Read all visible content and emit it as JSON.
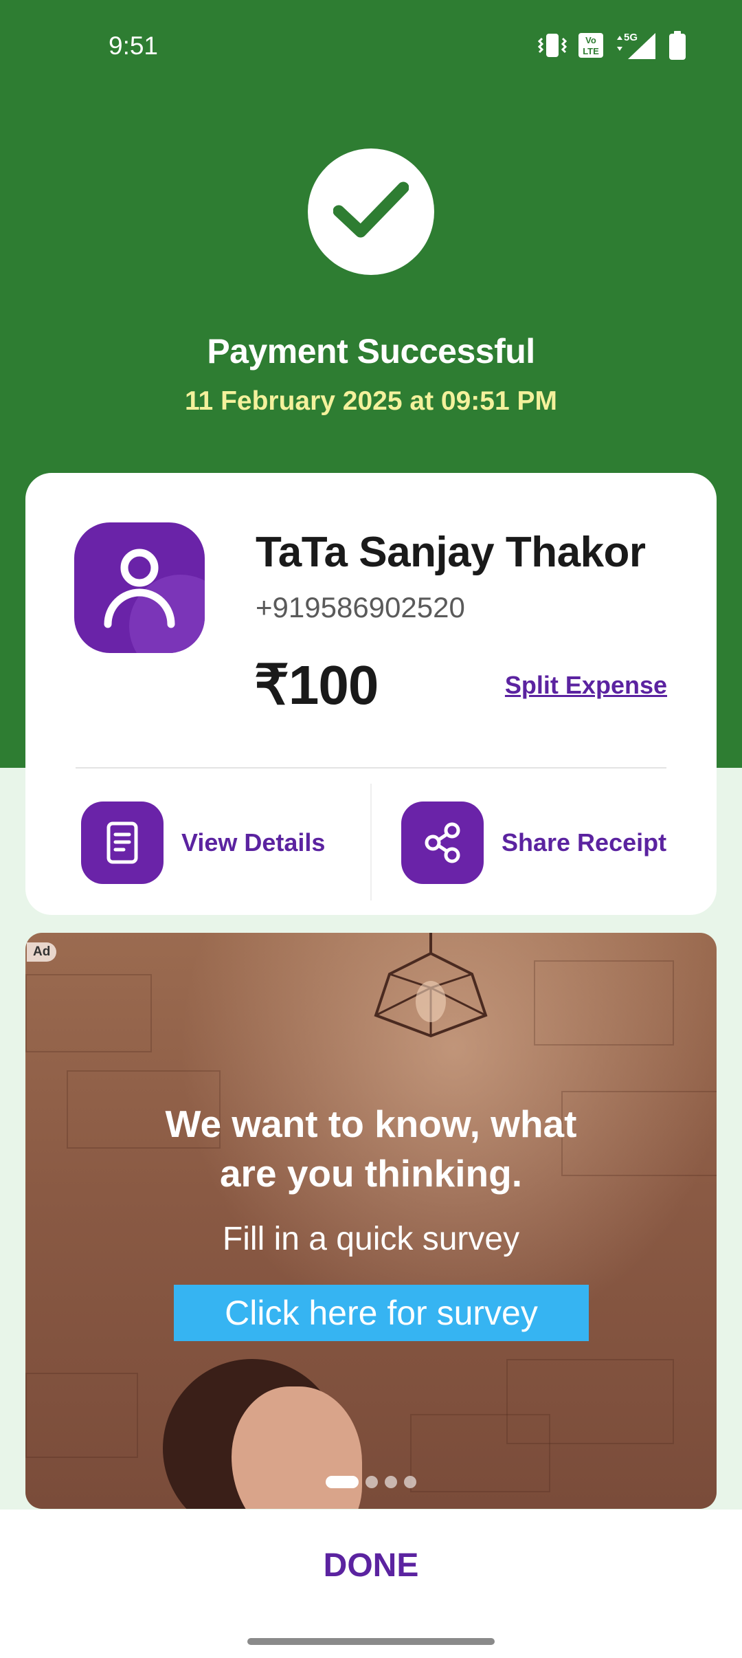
{
  "status_bar": {
    "time": "9:51",
    "icons": [
      "vibrate-icon",
      "volte-icon",
      "5g-signal-icon",
      "battery-icon"
    ]
  },
  "header": {
    "title": "Payment Successful",
    "datetime": "11 February 2025 at 09:51 PM",
    "icon": "check-icon"
  },
  "payment": {
    "payee_name": "TaTa Sanjay Thakor",
    "phone": "+919586902520",
    "amount": "₹100",
    "split_label": "Split Expense"
  },
  "actions": {
    "view_details": "View Details",
    "share_receipt": "Share Receipt"
  },
  "ad": {
    "badge": "Ad",
    "headline_1": "We want to know, what",
    "headline_2": "are you thinking.",
    "subline": "Fill in a quick survey",
    "cta": "Click here for survey",
    "carousel": {
      "count": 4,
      "active_index": 0
    }
  },
  "footer": {
    "done_label": "DONE"
  },
  "colors": {
    "header_green": "#2e7d32",
    "page_bg": "#e8f5e9",
    "accent_purple": "#6a23a8",
    "label_purple": "#5b23a0",
    "date_yellow": "#f4f19c",
    "ad_button": "#36b4f2"
  }
}
